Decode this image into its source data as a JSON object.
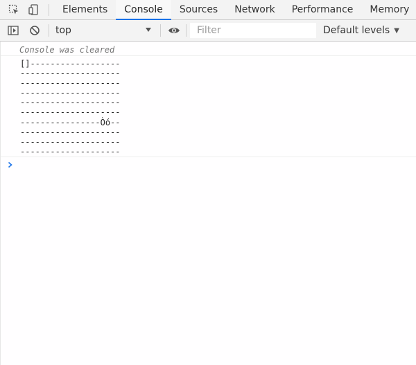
{
  "tabbar": {
    "tabs": [
      {
        "label": "Elements",
        "active": false
      },
      {
        "label": "Console",
        "active": true
      },
      {
        "label": "Sources",
        "active": false
      },
      {
        "label": "Network",
        "active": false
      },
      {
        "label": "Performance",
        "active": false
      },
      {
        "label": "Memory",
        "active": false
      }
    ]
  },
  "toolbar": {
    "context": "top",
    "filter_placeholder": "Filter",
    "levels_label": "Default levels"
  },
  "console": {
    "cleared_message": "Console was cleared",
    "output_lines": [
      "[]------------------",
      "--------------------",
      "--------------------",
      "--------------------",
      "--------------------",
      "--------------------",
      "----------------Òó--",
      "--------------------",
      "--------------------",
      "--------------------"
    ]
  },
  "colors": {
    "accent": "#1a73e8",
    "prompt": "#1a73e8"
  }
}
